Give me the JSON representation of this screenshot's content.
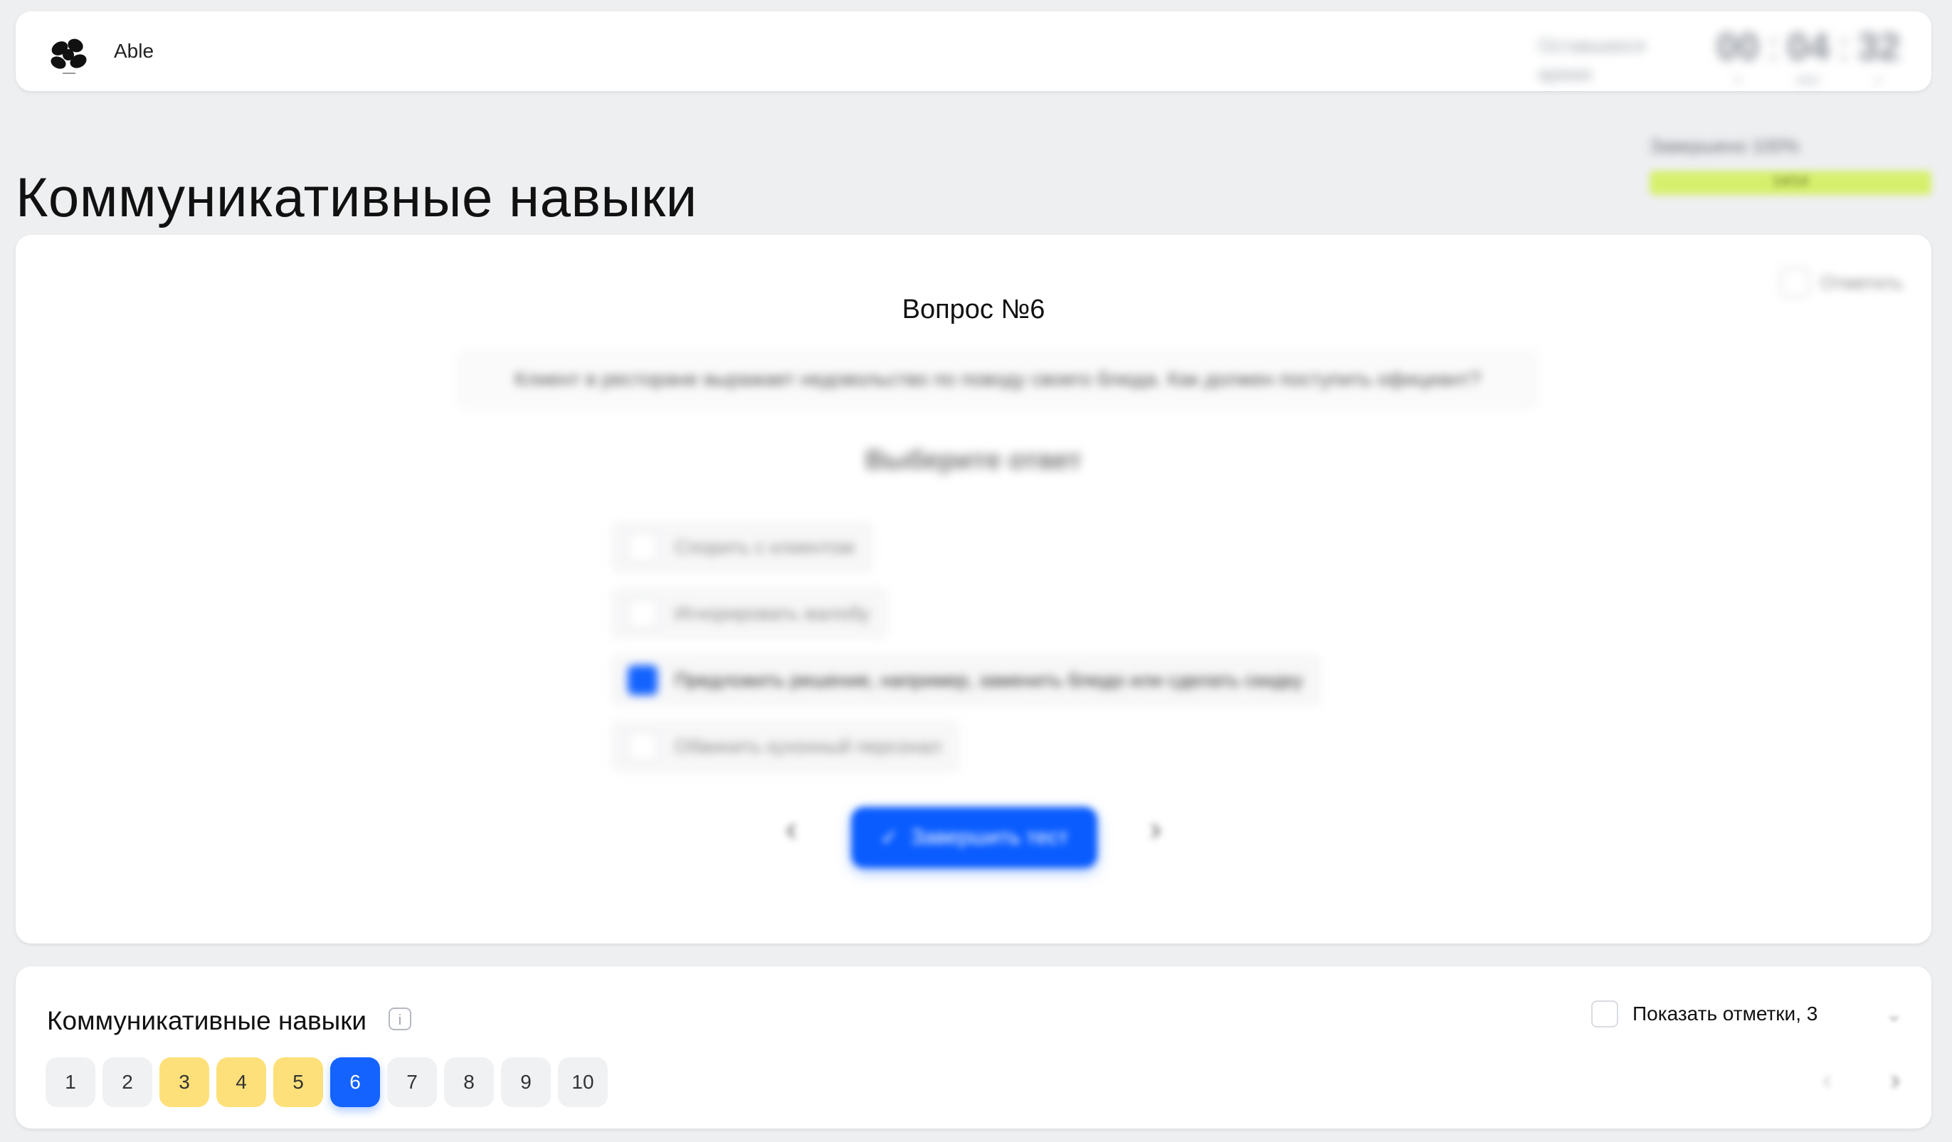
{
  "header": {
    "brand": "Able",
    "timer_label": "Оставшееся время",
    "timer": [
      {
        "value": "00",
        "unit": "ч"
      },
      {
        "value": "04",
        "unit": "мин"
      },
      {
        "value": "32",
        "unit": "с"
      }
    ]
  },
  "page": {
    "title": "Коммуникативные навыки",
    "progress_label": "Завершено 100%",
    "progress_count": "14/14",
    "progress_percent": 100
  },
  "question": {
    "mark_label": "Отметить",
    "title": "Вопрос №6",
    "text": "Клиент в ресторане выражает недовольство по поводу своего блюда. Как должен поступить официант?",
    "answer_heading": "Выберите ответ",
    "options": [
      {
        "label": "Спорить с клиентом",
        "selected": false
      },
      {
        "label": "Игнорировать жалобу",
        "selected": false
      },
      {
        "label": "Предложить решение, например, заменить блюдо или сделать скидку",
        "selected": true
      },
      {
        "label": "Обвинить кухонный персонал",
        "selected": false
      }
    ],
    "prev_icon": "‹",
    "next_icon": "›",
    "finish_icon": "✓",
    "finish_label": "Завершить тест"
  },
  "navigator": {
    "section_title": "Коммуникативные навыки",
    "info_icon": "i",
    "show_marks_label": "Показать отметки, 3",
    "collapse_icon": "⌄",
    "questions": [
      {
        "label": "1",
        "state": "default"
      },
      {
        "label": "2",
        "state": "default"
      },
      {
        "label": "3",
        "state": "marked"
      },
      {
        "label": "4",
        "state": "marked"
      },
      {
        "label": "5",
        "state": "marked"
      },
      {
        "label": "6",
        "state": "current"
      },
      {
        "label": "7",
        "state": "default"
      },
      {
        "label": "8",
        "state": "default"
      },
      {
        "label": "9",
        "state": "default"
      },
      {
        "label": "10",
        "state": "default"
      }
    ],
    "pager_prev_icon": "‹",
    "pager_next_icon": "›"
  }
}
